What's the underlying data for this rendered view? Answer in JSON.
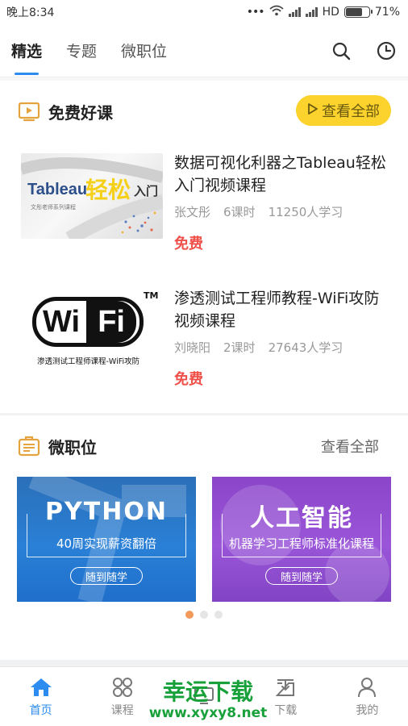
{
  "status_bar": {
    "time": "晚上8:34",
    "network": "HD",
    "battery": "71%",
    "battery_level": 0.71
  },
  "top_tabs": {
    "tabs": [
      {
        "label": "精选",
        "active": true
      },
      {
        "label": "专题",
        "active": false
      },
      {
        "label": "微职位",
        "active": false
      }
    ],
    "icons": [
      "search-icon",
      "clock-icon"
    ]
  },
  "free_courses": {
    "title": "免费好课",
    "icon": "play-screen-icon",
    "view_all": "查看全部",
    "courses": [
      {
        "title": "数据可视化利器之Tableau轻松入门视频课程",
        "teacher": "张文彤",
        "lessons": "6课时",
        "learners": "11250人学习",
        "price": "免费",
        "thumb": {
          "word": "Tableau",
          "highlight": "轻松",
          "tail": "入门",
          "sub": "文彤老师系列课程"
        }
      },
      {
        "title": "渗透测试工程师教程-WiFi攻防视频课程",
        "teacher": "刘晓阳",
        "lessons": "2课时",
        "learners": "27643人学习",
        "price": "免费",
        "thumb": {
          "wi": "Wi",
          "fi": "Fi",
          "tm": "TM",
          "sub": "渗透测试工程师课程-WiFi攻防"
        }
      }
    ]
  },
  "micro_jobs": {
    "title": "微职位",
    "icon": "briefcase-list-icon",
    "view_all": "查看全部",
    "cards": [
      {
        "headline": "PYTHON",
        "subtitle": "40周实现薪资翻倍",
        "button": "随到随学",
        "color": "#2a80d6"
      },
      {
        "headline": "人工智能",
        "subtitle": "机器学习工程师标准化课程",
        "button": "随到随学",
        "color": "#9a55d8"
      }
    ],
    "carousel_active_index": 0,
    "carousel_count": 3
  },
  "bottom_nav": {
    "items": [
      {
        "label": "首页",
        "icon": "home-icon",
        "active": true
      },
      {
        "label": "课程",
        "icon": "grid-circles-icon",
        "active": false
      },
      {
        "label": "",
        "icon": "monitor-icon",
        "active": false
      },
      {
        "label": "下载",
        "icon": "download-icon",
        "active": false
      },
      {
        "label": "我的",
        "icon": "user-icon",
        "active": false
      }
    ]
  },
  "watermark": {
    "line1": "幸运下载",
    "line2": "www.xyxy8.net"
  },
  "colors": {
    "accent": "#2c8cf0",
    "price": "#f0504a",
    "pill": "#fcd22d",
    "dot_active": "#f39a5b"
  }
}
